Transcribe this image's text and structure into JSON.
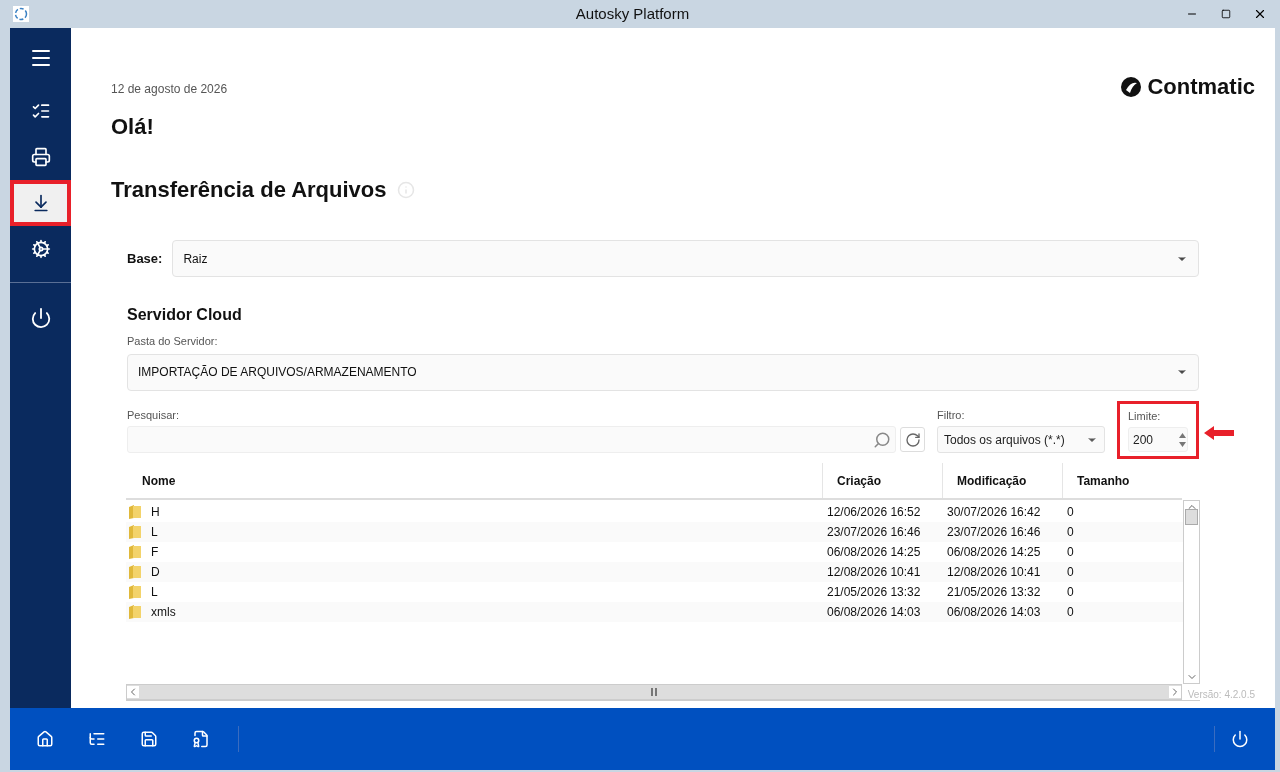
{
  "window": {
    "title": "Autosky Platform"
  },
  "sidebar": {
    "items": [
      {
        "kind": "list",
        "selected": false,
        "highlighted": false
      },
      {
        "kind": "print",
        "selected": false,
        "highlighted": false
      },
      {
        "kind": "download",
        "selected": true,
        "highlighted": true
      },
      {
        "kind": "settings",
        "selected": false,
        "highlighted": false
      }
    ]
  },
  "header": {
    "date": "12 de agosto de 2026",
    "greeting": "Olá!",
    "logo": "Contmatic"
  },
  "page_title": "Transferência de Arquivos",
  "base": {
    "label": "Base:",
    "value": "Raiz"
  },
  "server": {
    "heading": "Servidor Cloud",
    "folder_label": "Pasta do Servidor:",
    "folder_value": "IMPORTAÇÃO DE ARQUIVOS/ARMAZENAMENTO"
  },
  "search": {
    "label": "Pesquisar:"
  },
  "filter": {
    "label": "Filtro:",
    "value": "Todos os arquivos (*.*)"
  },
  "limit": {
    "label": "Limite:",
    "value": "200",
    "highlighted": true
  },
  "table": {
    "columns": [
      "Nome",
      "Criação",
      "Modificação",
      "Tamanho"
    ],
    "rows": [
      [
        "H",
        "12/06/2026 16:52",
        "30/07/2026 16:42",
        "0"
      ],
      [
        "L",
        "23/07/2026 16:46",
        "23/07/2026 16:46",
        "0"
      ],
      [
        "F",
        "06/08/2026 14:25",
        "06/08/2026 14:25",
        "0"
      ],
      [
        "D",
        "12/08/2026 10:41",
        "12/08/2026 10:41",
        "0"
      ],
      [
        "L",
        "21/05/2026 13:32",
        "21/05/2026 13:32",
        "0"
      ],
      [
        "xmls",
        "06/08/2026 14:03",
        "06/08/2026 14:03",
        "0"
      ]
    ]
  },
  "version": "Versão: 4.2.0.5",
  "bottom_bar": {
    "items": [
      {
        "kind": "home"
      },
      {
        "kind": "list"
      },
      {
        "kind": "save"
      },
      {
        "kind": "certificate"
      }
    ]
  }
}
